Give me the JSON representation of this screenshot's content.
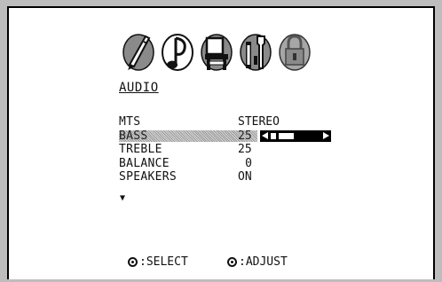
{
  "menu_icons": [
    "picture-brush-icon",
    "audio-note-icon",
    "setup-chair-icon",
    "features-tools-icon",
    "lock-icon"
  ],
  "title": "AUDIO",
  "items": [
    {
      "label": "MTS",
      "value": "STEREO"
    },
    {
      "label": "BASS",
      "value": "25",
      "selected": true,
      "level_percent": 50
    },
    {
      "label": "TREBLE",
      "value": "25"
    },
    {
      "label": "BALANCE",
      "value": "0"
    },
    {
      "label": "SPEAKERS",
      "value": "ON"
    }
  ],
  "more_indicator": "▼",
  "hints": {
    "select": ":SELECT",
    "adjust": ":ADJUST"
  },
  "colors": {
    "highlight": "#b0b0b0",
    "frame": "#bdbdbd",
    "text": "#111111"
  }
}
